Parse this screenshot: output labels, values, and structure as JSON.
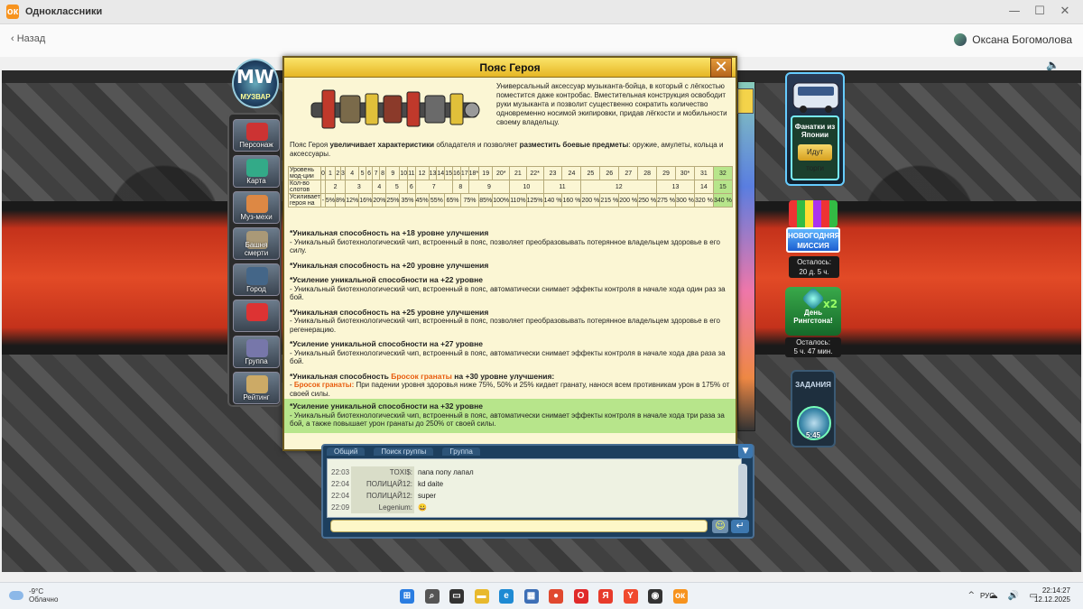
{
  "window": {
    "title": "Одноклассники",
    "logo_glyph": "ок",
    "min_glyph": "—",
    "max_glyph": "☐",
    "close_glyph": "✕"
  },
  "nav": {
    "back_label": "‹  Назад",
    "user_name": "Оксана Богомолова",
    "speaker_glyph": "🔈"
  },
  "game": {
    "logo_mw": "MW",
    "logo_sub": "МУЗВАР",
    "menu": [
      {
        "label": "Персонаж",
        "color": "#c33"
      },
      {
        "label": "Карта",
        "color": "#3a8"
      },
      {
        "label": "Муз-мехи",
        "color": "#d84"
      },
      {
        "label": "Башня смерти",
        "color": "#a97"
      },
      {
        "label": "Город",
        "color": "#468"
      },
      {
        "label": "",
        "color": "#d33"
      },
      {
        "label": "Группа",
        "color": "#77a"
      },
      {
        "label": "Рейтинг",
        "color": "#ca6"
      }
    ]
  },
  "modal": {
    "title": "Пояс Героя",
    "close_glyph": "✕",
    "description": "Универсальный аксессуар музыканта-бойца, в который с лёгкостью поместится даже контробас. Вместительная конструкция освободит руки музыканта и позволит существенно сократить количество одновременно носимой экипировки, придав лёгкости и мобильности своему владельцу.",
    "intro_a": "Пояс Героя ",
    "intro_b": "увеличивает характеристики",
    "intro_c": " обладателя и позволяет ",
    "intro_d": "разместить боевые предметы",
    "intro_e": ": оружие, амулеты, кольца и аксессуары.",
    "table": {
      "row1_label": "Уровень мод-ции",
      "row2_label": "Кол-во слотов",
      "row3_label": "Усиливает героя на",
      "levels": [
        "0",
        "1",
        "2",
        "3",
        "4",
        "5",
        "6",
        "7",
        "8",
        "9",
        "10",
        "11",
        "12",
        "13",
        "14",
        "15",
        "16",
        "17",
        "18*",
        "19",
        "20*",
        "21",
        "22*",
        "23",
        "24",
        "25",
        "26",
        "27",
        "28",
        "29",
        "30*",
        "31",
        "32"
      ],
      "slots": [
        {
          "v": "",
          "span": 1
        },
        {
          "v": "2",
          "span": 3
        },
        {
          "v": "3",
          "span": 3
        },
        {
          "v": "4",
          "span": 2
        },
        {
          "v": "5",
          "span": 2
        },
        {
          "v": "6",
          "span": 1
        },
        {
          "v": "7",
          "span": 4
        },
        {
          "v": "8",
          "span": 2
        },
        {
          "v": "9",
          "span": 3
        },
        {
          "v": "10",
          "span": 2
        },
        {
          "v": "11",
          "span": 2
        },
        {
          "v": "12",
          "span": 4
        },
        {
          "v": "13",
          "span": 2
        },
        {
          "v": "14",
          "span": 1
        },
        {
          "v": "15",
          "span": 4
        }
      ],
      "boost": [
        {
          "v": "-",
          "span": 1
        },
        {
          "v": "5%",
          "span": 1
        },
        {
          "v": "8%",
          "span": 2
        },
        {
          "v": "12%",
          "span": 1
        },
        {
          "v": "16%",
          "span": 2
        },
        {
          "v": "20%",
          "span": 2
        },
        {
          "v": "25%",
          "span": 1
        },
        {
          "v": "35%",
          "span": 2
        },
        {
          "v": "45%",
          "span": 1
        },
        {
          "v": "55%",
          "span": 2
        },
        {
          "v": "65%",
          "span": 2
        },
        {
          "v": "75%",
          "span": 2
        },
        {
          "v": "85%",
          "span": 1
        },
        {
          "v": "100%",
          "span": 1
        },
        {
          "v": "110%",
          "span": 1
        },
        {
          "v": "125%",
          "span": 1
        },
        {
          "v": "140 %",
          "span": 1
        },
        {
          "v": "160 %",
          "span": 1
        },
        {
          "v": "200 %",
          "span": 1
        },
        {
          "v": "215 %",
          "span": 1
        },
        {
          "v": "200 %",
          "span": 1
        },
        {
          "v": "250 %",
          "span": 1
        },
        {
          "v": "275 %",
          "span": 1
        },
        {
          "v": "300 %",
          "span": 1
        },
        {
          "v": "320 %",
          "span": 1
        },
        {
          "v": "340 %",
          "span": 1
        }
      ]
    },
    "abilities": [
      {
        "title": "*Уникальная способность на +18 уровне улучшения",
        "text": "- Уникальный биотехнологический чип, встроенный в пояс, позволяет преобразовывать потерянное владельцем здоровье в его силу."
      },
      {
        "title": "*Уникальная способность на +20 уровне улучшения",
        "text": ""
      },
      {
        "title": "*Усиление уникальной способности на +22 уровне",
        "text": "- Уникальный биотехнологический чип, встроенный в пояс, автоматически снимает эффекты контроля в начале хода один раз за бой."
      },
      {
        "title": "*Уникальная способность на +25 уровне улучшения",
        "text": "- Уникальный биотехнологический чип, встроенный в пояс, позволяет преобразовывать потерянное владельцем здоровье в его регенерацию."
      },
      {
        "title": "*Усиление уникальной способности на +27 уровне",
        "text": "- Уникальный биотехнологический чип, встроенный в пояс, автоматически снимает эффекты контроля в начале хода два раза за бой."
      }
    ],
    "grenade": {
      "t1": "*Уникальная способность ",
      "t2": "Бросок гранаты",
      "t3": " на +30 уровне улучшения",
      "t4": ":",
      "d1": "- ",
      "d2": "Бросок гранаты:",
      "d3": " При падении уровня здоровья ниже 75%, 50% и 25% кидает гранату, нанося всем противникам урон в 175% от своей силы."
    },
    "last": {
      "title": "*Усиление уникальной способности на +32 уровне",
      "text": "- Уникальный биотехнологический чип, встроенный в пояс, автоматически снимает эффекты контроля в начале хода три раза за бой, а также повышает урон гранаты до 250% от своей силы."
    }
  },
  "right": {
    "bus_title": "Фанатки из Японии",
    "bus_button": "Идут торги",
    "ny_title": "НОВОГОДНЯЯ МИССИЯ",
    "ny_left": "Осталось:",
    "ny_time": "20 д. 5 ч.",
    "ring_title": "День Рингстона!",
    "ring_x2": "x2",
    "ring_left": "Осталось:",
    "ring_time": "5 ч. 47 мин.",
    "tasks_label": "ЗАДАНИЯ",
    "tasks_time": "5:45"
  },
  "chat": {
    "tabs": [
      "Общий",
      "Поиск группы",
      "Группа"
    ],
    "rows": [
      {
        "time": "22:03",
        "name": "TOXI$:",
        "msg": "папа попу лапал"
      },
      {
        "time": "22:04",
        "name": "ПОЛИЦАЙ12:",
        "msg": "kd daite"
      },
      {
        "time": "22:04",
        "name": "ПОЛИЦАЙ12:",
        "msg": "super"
      },
      {
        "time": "22:09",
        "name": "Legenium:",
        "msg": "😀"
      }
    ],
    "smile_glyph": "☺",
    "send_glyph": "↵",
    "dropdown_glyph": "▼"
  },
  "taskbar": {
    "temp": "-9°C",
    "weather": "Облачно",
    "lang": "РУС",
    "time": "22:14:27",
    "date": "12.12.2025",
    "chevron": "^",
    "tray_icons": "☁ 🔊 ▭",
    "apps": [
      {
        "name": "start-icon",
        "color": "#2a7de1",
        "glyph": "⊞"
      },
      {
        "name": "search-icon",
        "color": "#555",
        "glyph": "⌕"
      },
      {
        "name": "taskview-icon",
        "color": "#333",
        "glyph": "▭"
      },
      {
        "name": "explorer-icon",
        "color": "#e8b92d",
        "glyph": "▬"
      },
      {
        "name": "edge-icon",
        "color": "#1e8ad3",
        "glyph": "e"
      },
      {
        "name": "store-icon",
        "color": "#3d6fb6",
        "glyph": "▦"
      },
      {
        "name": "chrome-icon",
        "color": "#e0492f",
        "glyph": "●"
      },
      {
        "name": "opera-icon",
        "color": "#e02a2a",
        "glyph": "O"
      },
      {
        "name": "yandex-icon",
        "color": "#e73b2b",
        "glyph": "Я"
      },
      {
        "name": "yandex-browser-icon",
        "color": "#f04a2f",
        "glyph": "Y"
      },
      {
        "name": "media-icon",
        "color": "#333",
        "glyph": "◉"
      },
      {
        "name": "ok-icon",
        "color": "#f7931e",
        "glyph": "ок"
      }
    ]
  }
}
